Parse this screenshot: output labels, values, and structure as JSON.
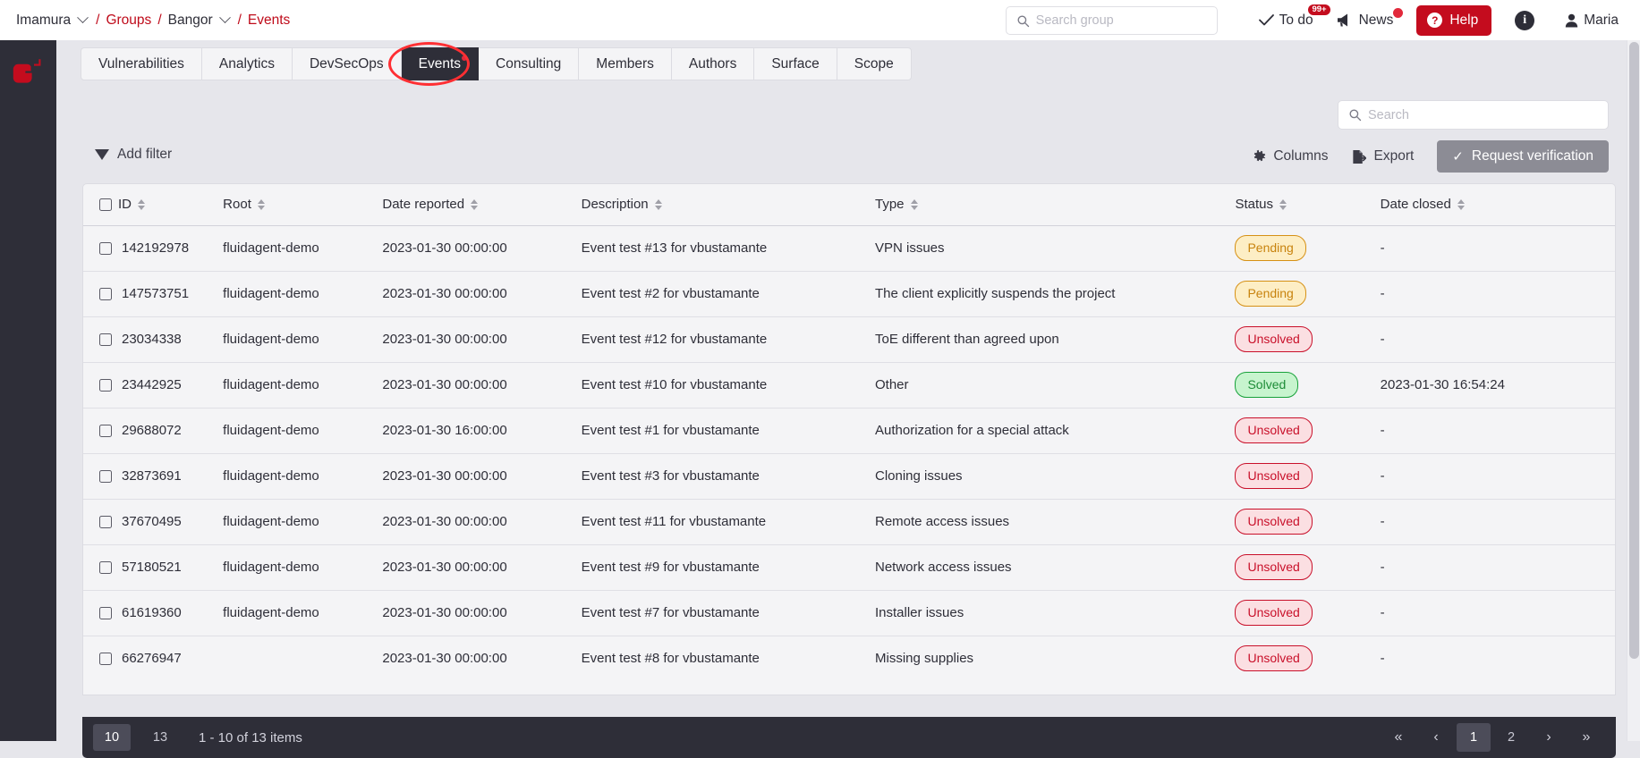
{
  "breadcrumb": {
    "org": "Imamura",
    "groups": "Groups",
    "group": "Bangor",
    "page": "Events",
    "separator": "/"
  },
  "header": {
    "group_search_placeholder": "Search group",
    "group_search_value": "",
    "todo_label": "To do",
    "todo_badge": "99+",
    "news_label": "News",
    "help_label": "Help",
    "user_label": "Maria",
    "brand_red": "#c40c1e",
    "icons": {
      "search": "search-icon",
      "check": "check-icon",
      "megaphone": "megaphone-icon",
      "question": "question-mark-icon",
      "info": "info-icon",
      "user": "user-icon"
    }
  },
  "tabs": [
    {
      "label": "Vulnerabilities",
      "active": false
    },
    {
      "label": "Analytics",
      "active": false
    },
    {
      "label": "DevSecOps",
      "active": false
    },
    {
      "label": "Events",
      "active": true
    },
    {
      "label": "Consulting",
      "active": false
    },
    {
      "label": "Members",
      "active": false
    },
    {
      "label": "Authors",
      "active": false
    },
    {
      "label": "Surface",
      "active": false
    },
    {
      "label": "Scope",
      "active": false
    }
  ],
  "toolbar": {
    "add_filter_label": "Add filter",
    "search_placeholder": "Search",
    "search_value": "",
    "columns_label": "Columns",
    "export_label": "Export",
    "request_verification_label": "Request verification",
    "request_verification_disabled": true
  },
  "table": {
    "columns": [
      {
        "key": "id",
        "label": "ID"
      },
      {
        "key": "root",
        "label": "Root"
      },
      {
        "key": "date_reported",
        "label": "Date reported"
      },
      {
        "key": "description",
        "label": "Description"
      },
      {
        "key": "type",
        "label": "Type"
      },
      {
        "key": "status",
        "label": "Status"
      },
      {
        "key": "date_closed",
        "label": "Date closed"
      }
    ],
    "rows": [
      {
        "id": "142192978",
        "root": "fluidagent-demo",
        "date_reported": "2023-01-30 00:00:00",
        "description": "Event test #13 for vbustamante",
        "type": "VPN issues",
        "status": "Pending",
        "status_kind": "pending",
        "date_closed": "-"
      },
      {
        "id": "147573751",
        "root": "fluidagent-demo",
        "date_reported": "2023-01-30 00:00:00",
        "description": "Event test #2 for vbustamante",
        "type": "The client explicitly suspends the project",
        "status": "Pending",
        "status_kind": "pending",
        "date_closed": "-"
      },
      {
        "id": "23034338",
        "root": "fluidagent-demo",
        "date_reported": "2023-01-30 00:00:00",
        "description": "Event test #12 for vbustamante",
        "type": "ToE different than agreed upon",
        "status": "Unsolved",
        "status_kind": "unsolved",
        "date_closed": "-"
      },
      {
        "id": "23442925",
        "root": "fluidagent-demo",
        "date_reported": "2023-01-30 00:00:00",
        "description": "Event test #10 for vbustamante",
        "type": "Other",
        "status": "Solved",
        "status_kind": "solved",
        "date_closed": "2023-01-30 16:54:24"
      },
      {
        "id": "29688072",
        "root": "fluidagent-demo",
        "date_reported": "2023-01-30 16:00:00",
        "description": "Event test #1 for vbustamante",
        "type": "Authorization for a special attack",
        "status": "Unsolved",
        "status_kind": "unsolved",
        "date_closed": "-"
      },
      {
        "id": "32873691",
        "root": "fluidagent-demo",
        "date_reported": "2023-01-30 00:00:00",
        "description": "Event test #3 for vbustamante",
        "type": "Cloning issues",
        "status": "Unsolved",
        "status_kind": "unsolved",
        "date_closed": "-"
      },
      {
        "id": "37670495",
        "root": "fluidagent-demo",
        "date_reported": "2023-01-30 00:00:00",
        "description": "Event test #11 for vbustamante",
        "type": "Remote access issues",
        "status": "Unsolved",
        "status_kind": "unsolved",
        "date_closed": "-"
      },
      {
        "id": "57180521",
        "root": "fluidagent-demo",
        "date_reported": "2023-01-30 00:00:00",
        "description": "Event test #9 for vbustamante",
        "type": "Network access issues",
        "status": "Unsolved",
        "status_kind": "unsolved",
        "date_closed": "-"
      },
      {
        "id": "61619360",
        "root": "fluidagent-demo",
        "date_reported": "2023-01-30 00:00:00",
        "description": "Event test #7 for vbustamante",
        "type": "Installer issues",
        "status": "Unsolved",
        "status_kind": "unsolved",
        "date_closed": "-"
      },
      {
        "id": "66276947",
        "root": "",
        "date_reported": "2023-01-30 00:00:00",
        "description": "Event test #8 for vbustamante",
        "type": "Missing supplies",
        "status": "Unsolved",
        "status_kind": "unsolved",
        "date_closed": "-"
      }
    ]
  },
  "pagination": {
    "page_size_options": [
      "10",
      "13"
    ],
    "page_size_selected": "10",
    "range_text": "1 - 10 of 13 items",
    "first_label": "«",
    "prev_label": "‹",
    "pages": [
      "1",
      "2"
    ],
    "current_page": "1",
    "next_label": "›",
    "last_label": "»"
  },
  "status_colors": {
    "pending_border": "#d69115",
    "pending_bg": "#fdeec5",
    "unsolved_border": "#c9102a",
    "unsolved_bg": "#fbdfe2",
    "solved_border": "#18a13a",
    "solved_bg": "#c7f4ce"
  }
}
